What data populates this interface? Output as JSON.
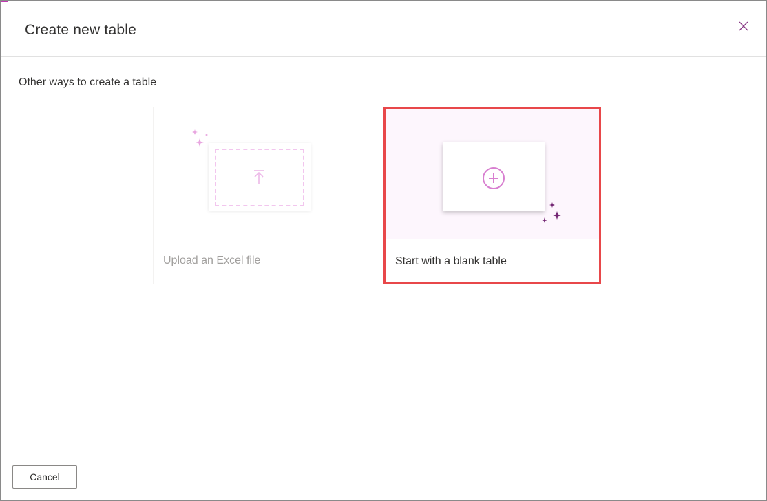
{
  "dialog": {
    "title": "Create new table",
    "close_icon": "close-icon"
  },
  "section": {
    "label": "Other ways to create a table"
  },
  "cards": [
    {
      "label": "Upload an Excel file",
      "icon": "upload-icon",
      "state": "disabled"
    },
    {
      "label": "Start with a blank table",
      "icon": "plus-circle-icon",
      "state": "highlighted"
    }
  ],
  "footer": {
    "cancel_label": "Cancel"
  },
  "colors": {
    "accent": "#c239b3",
    "highlight_border": "#e8474a",
    "sparkle": "#742774"
  }
}
